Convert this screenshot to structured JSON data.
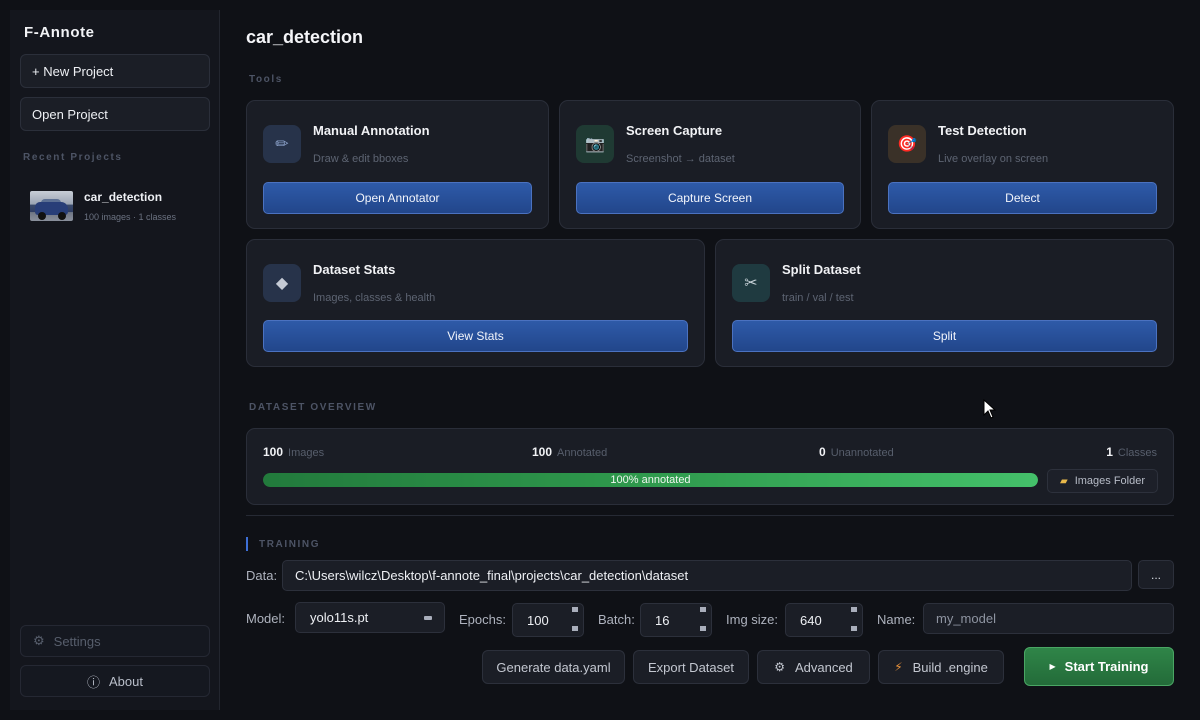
{
  "sidebar": {
    "brand": "F-Annote",
    "new_project": "+ New Project",
    "open_project": "Open Project",
    "recent_label": "Recent Projects",
    "recent": [
      {
        "name": "car_detection",
        "meta": "100 images  ·  1 classes"
      }
    ],
    "settings": "Settings",
    "about": "About",
    "settings_icon": "gear-icon",
    "about_icon": "info-icon"
  },
  "main": {
    "title": "car_detection",
    "tools_label": "Tools",
    "tools": [
      {
        "title": "Manual Annotation",
        "subtitle": "Draw & edit bboxes",
        "button": "Open Annotator",
        "icon": "pencil-icon",
        "icon_glyph": "✏",
        "icon_bg": "#27334a",
        "icon_color": "#8aa0c8"
      },
      {
        "title": "Screen Capture",
        "subtitle": "Screenshot → dataset",
        "button": "Capture Screen",
        "icon": "camera-icon",
        "icon_glyph": "📷",
        "icon_bg": "#1f3a33",
        "icon_color": "#9fb6b0"
      },
      {
        "title": "Test Detection",
        "subtitle": "Live overlay on screen",
        "button": "Detect",
        "icon": "target-icon",
        "icon_glyph": "🎯",
        "icon_bg": "#3a3128",
        "icon_color": "#e06a5a"
      },
      {
        "title": "Dataset Stats",
        "subtitle": "Images, classes & health",
        "button": "View Stats",
        "icon": "diamond-icon",
        "icon_glyph": "◆",
        "icon_bg": "#27334a",
        "icon_color": "#c5cbd6"
      },
      {
        "title": "Split Dataset",
        "subtitle": "train / val / test",
        "button": "Split",
        "icon": "scissors-icon",
        "icon_glyph": "✂",
        "icon_bg": "#1f3a40",
        "icon_color": "#c5d0d6"
      }
    ],
    "overview_label": "Dataset Overview",
    "overview": {
      "images_count": "100",
      "images_label": "Images",
      "annotated_count": "100",
      "annotated_label": "Annotated",
      "unannotated_count": "0",
      "unannotated_label": "Unannotated",
      "classes_count": "1",
      "classes_label": "Classes",
      "progress_fraction": 1.0,
      "progress_text": "100%  annotated",
      "folder_button": "Images Folder",
      "folder_icon": "folder-icon"
    },
    "training_label": "Training",
    "training": {
      "data_label": "Data:",
      "data_value": "C:\\Users\\wilcz\\Desktop\\f-annote_final\\projects\\car_detection\\dataset",
      "browse_label": "...",
      "model_label": "Model:",
      "model_value": "yolo11s.pt",
      "epochs_label": "Epochs:",
      "epochs_value": "100",
      "batch_label": "Batch:",
      "batch_value": "16",
      "imgsize_label": "Img size:",
      "imgsize_value": "640",
      "name_label": "Name:",
      "name_placeholder": "my_model",
      "generate_yaml": "Generate data.yaml",
      "export_dataset": "Export Dataset",
      "advanced": "Advanced",
      "build_engine": "Build .engine",
      "start_training": "Start Training",
      "advanced_icon": "gear-icon",
      "build_icon": "lightning-icon",
      "start_icon": "play-icon"
    }
  }
}
